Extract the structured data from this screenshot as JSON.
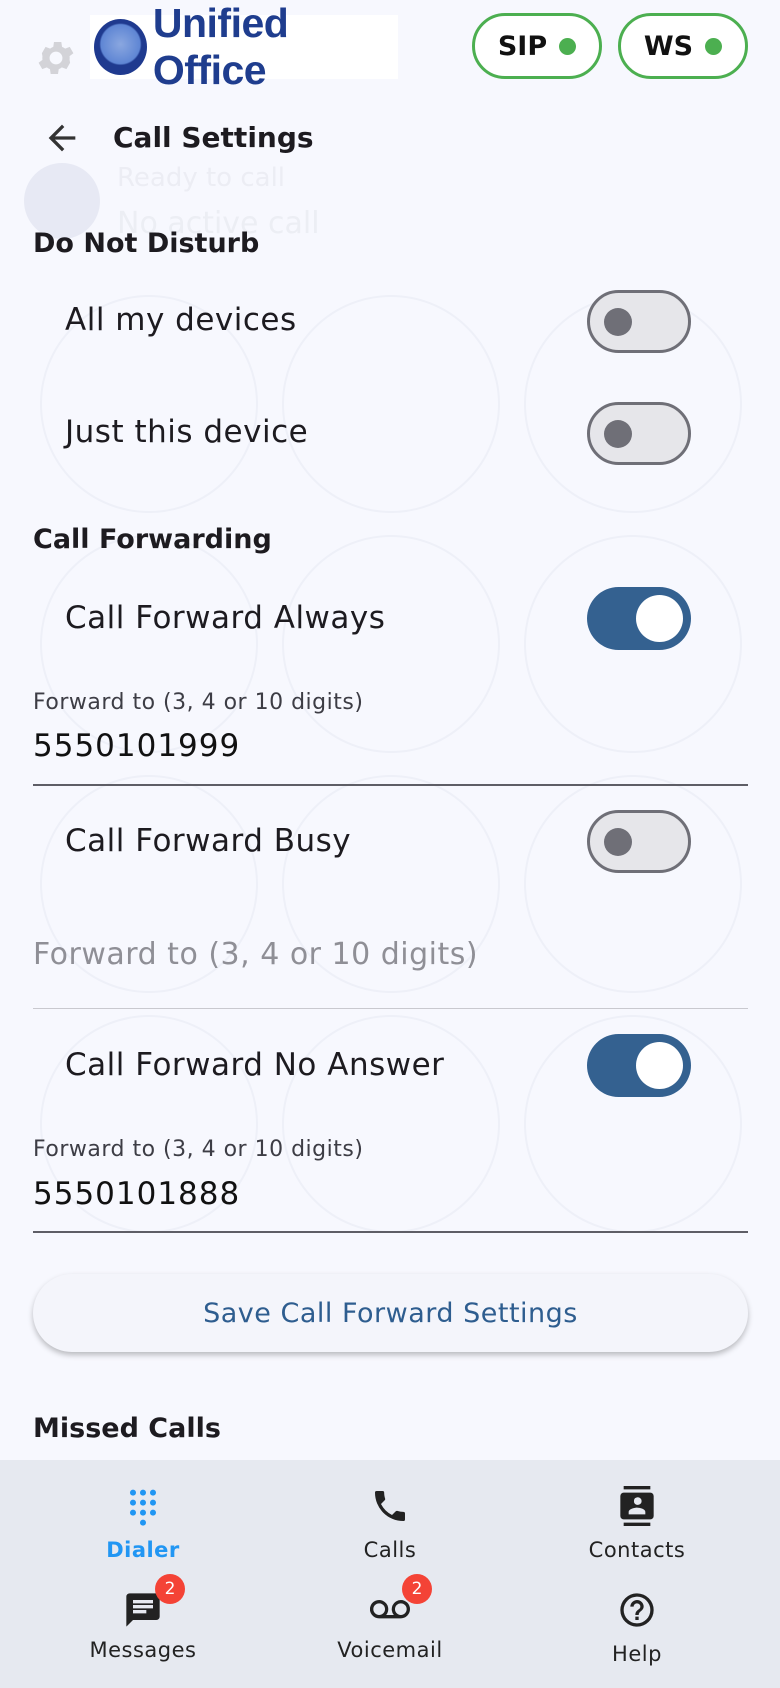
{
  "header": {
    "brand": "Unified Office",
    "status_pills": [
      {
        "label": "SIP",
        "status_color": "#4caf50"
      },
      {
        "label": "WS",
        "status_color": "#4caf50"
      }
    ]
  },
  "page": {
    "title": "Call Settings"
  },
  "background_dialer": {
    "status": "Ready to call",
    "call_state": "No active call"
  },
  "do_not_disturb": {
    "heading": "Do Not Disturb",
    "items": [
      {
        "label": "All my devices",
        "on": false
      },
      {
        "label": "Just this device",
        "on": false
      }
    ]
  },
  "call_forwarding": {
    "heading": "Call Forwarding",
    "always": {
      "label": "Call Forward Always",
      "on": true,
      "field_label": "Forward to (3, 4 or 10 digits)",
      "value": "5550101999"
    },
    "busy": {
      "label": "Call Forward Busy",
      "on": false,
      "placeholder": "Forward to (3, 4 or 10 digits)",
      "value": ""
    },
    "no_answer": {
      "label": "Call Forward No Answer",
      "on": true,
      "field_label": "Forward to (3, 4 or 10 digits)",
      "value": "5550101888"
    },
    "save_label": "Save Call Forward Settings"
  },
  "missed_calls": {
    "heading": "Missed Calls"
  },
  "bottom_nav": {
    "items": [
      {
        "label": "Dialer",
        "icon": "dialpad-icon",
        "active": true,
        "badge": ""
      },
      {
        "label": "Calls",
        "icon": "phone-icon",
        "active": false,
        "badge": ""
      },
      {
        "label": "Contacts",
        "icon": "contacts-icon",
        "active": false,
        "badge": ""
      },
      {
        "label": "Messages",
        "icon": "message-icon",
        "active": false,
        "badge": "2"
      },
      {
        "label": "Voicemail",
        "icon": "voicemail-icon",
        "active": false,
        "badge": "2"
      },
      {
        "label": "Help",
        "icon": "help-icon",
        "active": false,
        "badge": ""
      }
    ]
  },
  "colors": {
    "accent": "#346190",
    "active_nav": "#2196f3",
    "status_ok": "#4caf50",
    "badge": "#f44336"
  }
}
